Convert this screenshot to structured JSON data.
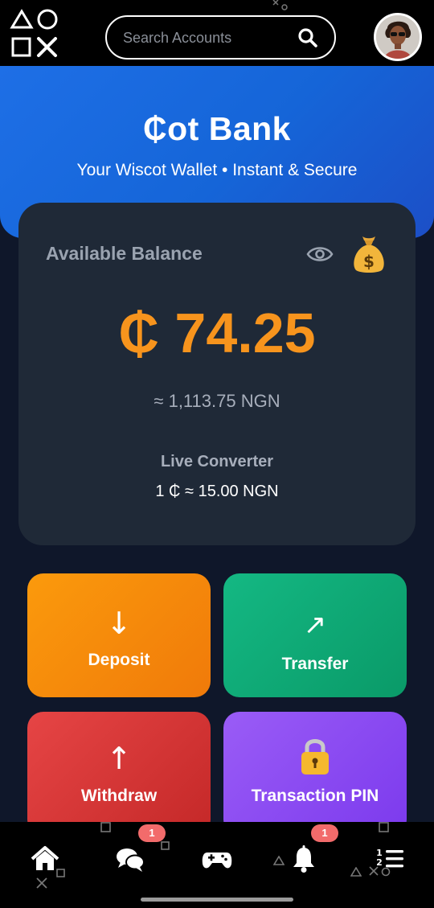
{
  "header": {
    "logo_icon": "playstation-shapes-icon",
    "search": {
      "placeholder": "Search Accounts",
      "value": ""
    },
    "search_icon": "search-icon",
    "avatar_icon": "user-avatar"
  },
  "hero": {
    "title": "₵ot Bank",
    "subtitle": "Your Wiscot Wallet • Instant & Secure",
    "colors": {
      "start": "#1e6fe6",
      "end": "#1c4fc7"
    }
  },
  "balance_card": {
    "label": "Available Balance",
    "eye_icon": "eye-icon",
    "money_icon": "money-bag-icon",
    "amount": "₵ 74.25",
    "approx": "≈ 1,113.75 NGN",
    "converter_label": "Live Converter",
    "converter_rate": "1 ₵ ≈ 15.00 NGN",
    "amount_color": "#f7941d"
  },
  "actions": [
    {
      "label": "Deposit",
      "glyph": "↓",
      "icon": "arrow-down-icon",
      "color": "#f98a0c"
    },
    {
      "label": "Transfer",
      "glyph": "↗",
      "icon": "arrow-up-right-icon",
      "color": "#10a975"
    },
    {
      "label": "Withdraw",
      "glyph": "↑",
      "icon": "arrow-up-icon",
      "color": "#d83636"
    },
    {
      "label": "Transaction PIN",
      "glyph": "🔒",
      "icon": "lock-icon",
      "color": "#8b4cf1"
    }
  ],
  "bottom_nav": {
    "items": [
      {
        "icon": "home-icon",
        "badge": ""
      },
      {
        "icon": "chat-icon",
        "badge": "1"
      },
      {
        "icon": "gamepad-icon",
        "badge": ""
      },
      {
        "icon": "bell-icon",
        "badge": "1"
      },
      {
        "icon": "numbered-list-icon",
        "badge": ""
      }
    ],
    "badge_color": "#f26b6b"
  }
}
